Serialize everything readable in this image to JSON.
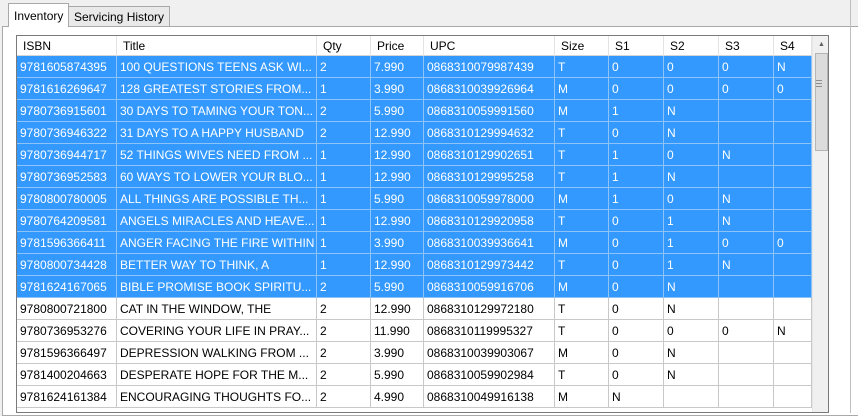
{
  "tabs": [
    {
      "label": "Inventory",
      "active": true
    },
    {
      "label": "Servicing History",
      "active": false
    }
  ],
  "colors": {
    "selection": "#3399ff",
    "selection_text": "#ffffff"
  },
  "grid": {
    "columns": [
      "ISBN",
      "Title",
      "Qty",
      "Price",
      "UPC",
      "Size",
      "S1",
      "S2",
      "S3",
      "S4"
    ],
    "rows": [
      {
        "selected": true,
        "cells": [
          "9781605874395",
          "100 QUESTIONS TEENS ASK WI...",
          "2",
          "7.990",
          "0868310079987439",
          "T",
          "0",
          "0",
          "0",
          "N"
        ]
      },
      {
        "selected": true,
        "cells": [
          "9781616269647",
          "128 GREATEST STORIES FROM...",
          "1",
          "3.990",
          "0868310039926964",
          "M",
          "0",
          "0",
          "0",
          "0"
        ]
      },
      {
        "selected": true,
        "cells": [
          "9780736915601",
          "30 DAYS TO TAMING YOUR TON...",
          "2",
          "5.990",
          "0868310059991560",
          "M",
          "1",
          "N",
          "",
          ""
        ]
      },
      {
        "selected": true,
        "cells": [
          "9780736946322",
          "31 DAYS TO A HAPPY HUSBAND",
          "2",
          "12.990",
          "0868310129994632",
          "T",
          "0",
          "N",
          "",
          ""
        ]
      },
      {
        "selected": true,
        "cells": [
          "9780736944717",
          "52 THINGS WIVES NEED FROM ...",
          "1",
          "12.990",
          "0868310129902651",
          "T",
          "1",
          "0",
          "N",
          ""
        ]
      },
      {
        "selected": true,
        "cells": [
          "9780736952583",
          "60 WAYS TO LOWER YOUR BLO...",
          "1",
          "12.990",
          "0868310129995258",
          "T",
          "1",
          "N",
          "",
          ""
        ]
      },
      {
        "selected": true,
        "cells": [
          "9780800780005",
          "ALL THINGS ARE POSSIBLE TH...",
          "1",
          "5.990",
          "0868310059978000",
          "M",
          "1",
          "0",
          "N",
          ""
        ]
      },
      {
        "selected": true,
        "cells": [
          "9780764209581",
          "ANGELS MIRACLES AND HEAVE...",
          "1",
          "12.990",
          "0868310129920958",
          "T",
          "0",
          "1",
          "N",
          ""
        ]
      },
      {
        "selected": true,
        "cells": [
          "9781596366411",
          "ANGER FACING THE FIRE WITHIN",
          "1",
          "3.990",
          "0868310039936641",
          "M",
          "0",
          "1",
          "0",
          "0"
        ]
      },
      {
        "selected": true,
        "cells": [
          "9780800734428",
          "BETTER WAY TO THINK, A",
          "1",
          "12.990",
          "0868310129973442",
          "T",
          "0",
          "1",
          "N",
          ""
        ]
      },
      {
        "selected": true,
        "cells": [
          "9781624167065",
          "BIBLE PROMISE BOOK SPIRITU...",
          "2",
          "5.990",
          "0868310059916706",
          "M",
          "0",
          "N",
          "",
          ""
        ]
      },
      {
        "selected": false,
        "cells": [
          "9780800721800",
          "CAT IN THE WINDOW, THE",
          "2",
          "12.990",
          "0868310129972180",
          "T",
          "0",
          "N",
          "",
          ""
        ]
      },
      {
        "selected": false,
        "cells": [
          "9780736953276",
          "COVERING YOUR LIFE IN PRAY...",
          "2",
          "11.990",
          "0868310119995327",
          "T",
          "0",
          "0",
          "0",
          "N"
        ]
      },
      {
        "selected": false,
        "cells": [
          "9781596366497",
          "DEPRESSION WALKING FROM ...",
          "2",
          "3.990",
          "0868310039903067",
          "M",
          "0",
          "N",
          "",
          ""
        ]
      },
      {
        "selected": false,
        "cells": [
          "9781400204663",
          "DESPERATE HOPE FOR THE M...",
          "2",
          "5.990",
          "0868310059902984",
          "T",
          "0",
          "N",
          "",
          ""
        ]
      },
      {
        "selected": false,
        "cells": [
          "9781624161384",
          "ENCOURAGING THOUGHTS FO...",
          "2",
          "4.990",
          "0868310049916138",
          "M",
          "N",
          "",
          "",
          ""
        ]
      }
    ]
  },
  "scrollbar": {
    "up_icon": "scroll-up-arrow-icon",
    "grip_icon": "scroll-grip-icon"
  }
}
